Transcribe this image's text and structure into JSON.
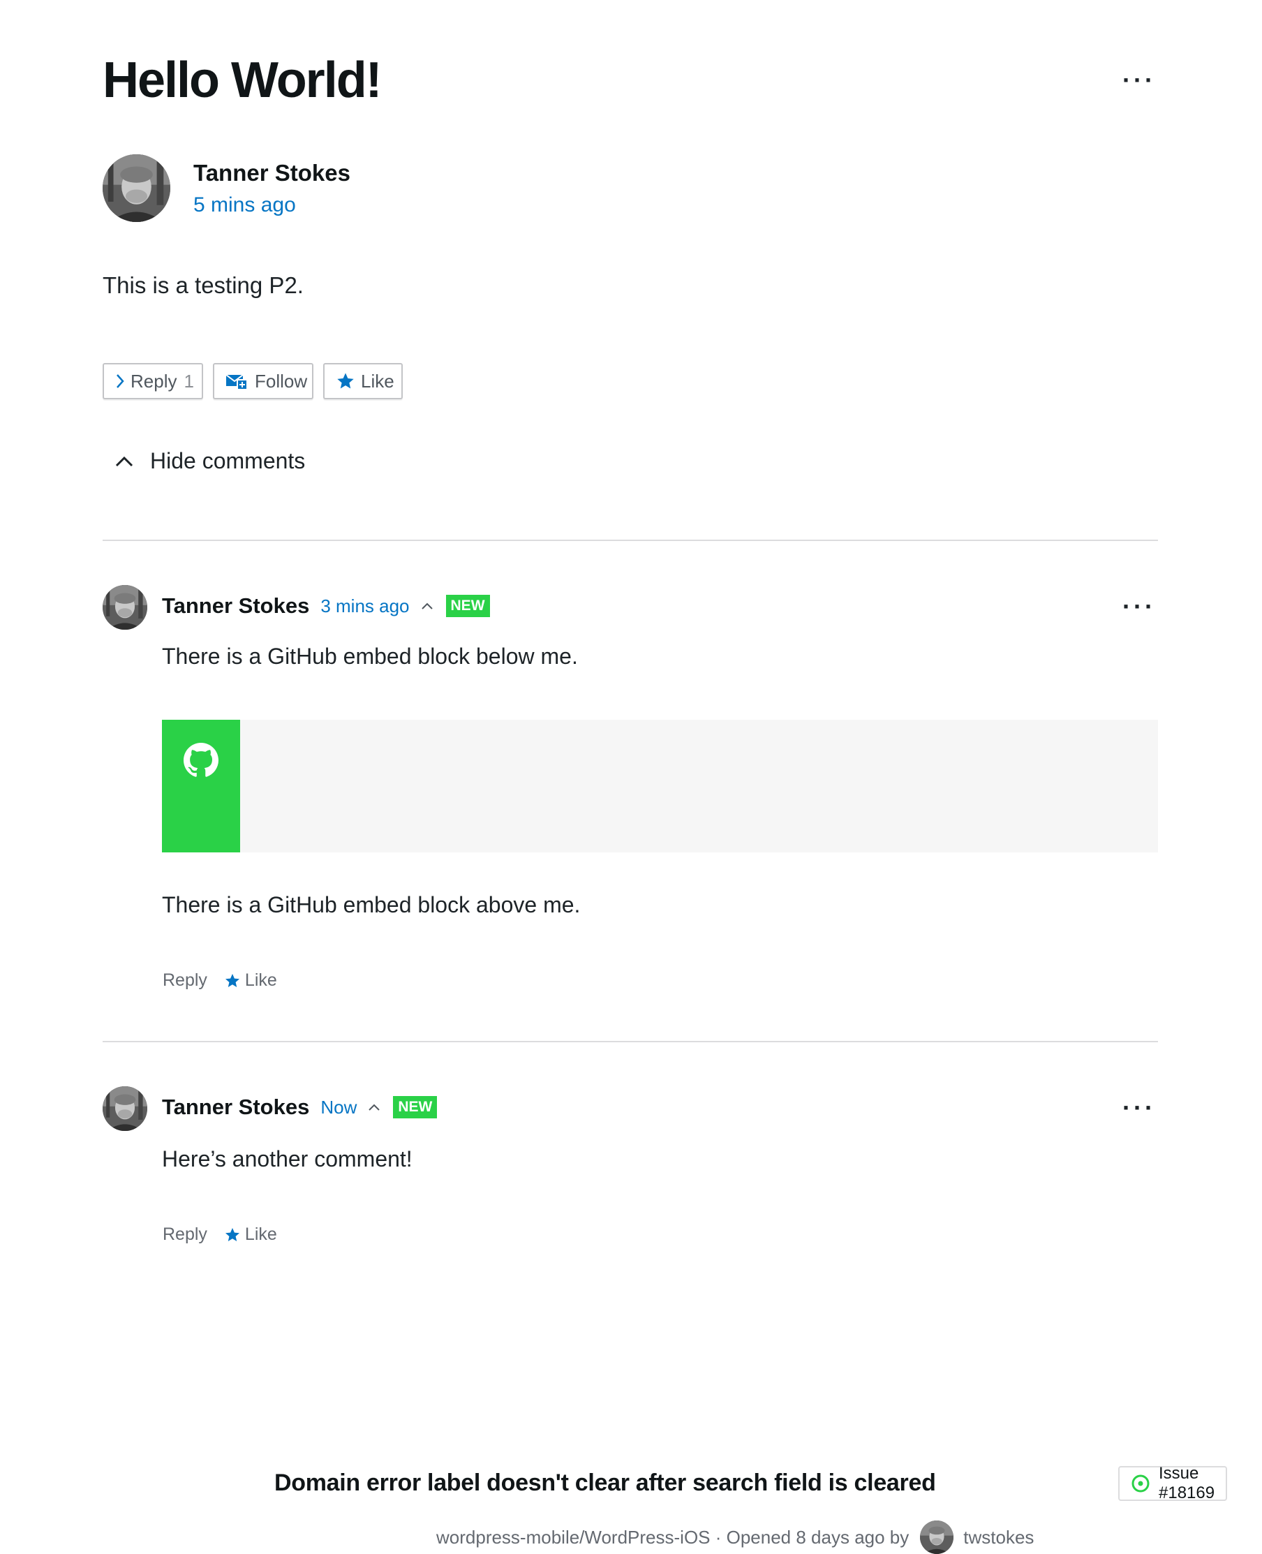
{
  "post": {
    "title": "Hello World!",
    "author": "Tanner Stokes",
    "time": "5 mins ago",
    "body": "This is a testing P2.",
    "more_label": "···",
    "actions": {
      "reply_label": "Reply",
      "reply_count": "1",
      "follow_label": "Follow",
      "like_label": "Like"
    },
    "hide_comments_label": "Hide comments"
  },
  "comments": [
    {
      "author": "Tanner Stokes",
      "time": "3 mins ago",
      "badge": "NEW",
      "text_before_embed": "There is a GitHub embed block below me.",
      "text_after_embed": "There is a GitHub embed block above me.",
      "embed": {
        "title": "Domain error label doesn't clear after search field is cleared",
        "issue_label": "Issue #18169",
        "meta_text": "wordpress-mobile/WordPress-iOS · Opened 8 days ago by",
        "user": "twstokes"
      },
      "reply_label": "Reply",
      "like_label": "Like"
    },
    {
      "author": "Tanner Stokes",
      "time": "Now",
      "badge": "NEW",
      "text": "Here’s another comment!",
      "reply_label": "Reply",
      "like_label": "Like"
    }
  ],
  "colors": {
    "link": "#0675c4",
    "accent_green": "#2ad147",
    "star": "#0675c4",
    "divider": "#dcdcde"
  },
  "icons": [
    "ellipsis-icon",
    "chevron-right-icon",
    "follow-mail-icon",
    "star-icon",
    "chevron-up-icon",
    "github-icon",
    "issue-open-icon"
  ]
}
